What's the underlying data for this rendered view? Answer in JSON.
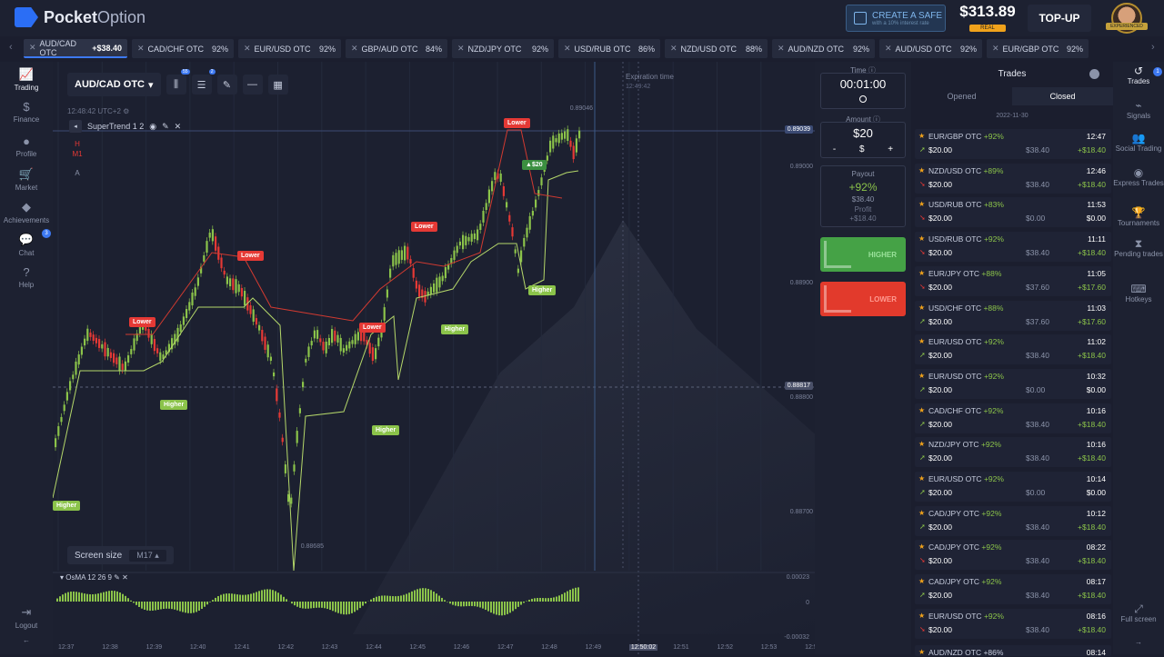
{
  "header": {
    "logo_bold": "Pocket",
    "logo_light": "Option",
    "safe_title": "CREATE A SAFE",
    "safe_sub": "with a 10% interest rate",
    "balance": "$313.89",
    "account_type": "REAL",
    "topup_label": "TOP-UP",
    "avatar_badge": "EXPERIENCED"
  },
  "ticker": [
    {
      "pair": "AUD/CAD OTC",
      "profit": "+$38.40",
      "active": true
    },
    {
      "pair": "CAD/CHF OTC",
      "pct": "92%"
    },
    {
      "pair": "EUR/USD OTC",
      "pct": "92%"
    },
    {
      "pair": "GBP/AUD OTC",
      "pct": "84%"
    },
    {
      "pair": "NZD/JPY OTC",
      "pct": "92%"
    },
    {
      "pair": "USD/RUB OTC",
      "pct": "86%"
    },
    {
      "pair": "NZD/USD OTC",
      "pct": "88%"
    },
    {
      "pair": "AUD/NZD OTC",
      "pct": "92%"
    },
    {
      "pair": "AUD/USD OTC",
      "pct": "92%"
    },
    {
      "pair": "EUR/GBP OTC",
      "pct": "92%"
    }
  ],
  "left_nav": [
    {
      "label": "Trading",
      "icon": "chart-icon"
    },
    {
      "label": "Finance",
      "icon": "dollar-icon"
    },
    {
      "label": "Profile",
      "icon": "user-icon"
    },
    {
      "label": "Market",
      "icon": "cart-icon"
    },
    {
      "label": "Achievements",
      "icon": "diamond-icon"
    },
    {
      "label": "Chat",
      "icon": "chat-icon",
      "badge": "3"
    },
    {
      "label": "Help",
      "icon": "help-icon"
    },
    {
      "label": "Logout",
      "icon": "logout-icon"
    }
  ],
  "chart": {
    "pair": "AUD/CAD OTC",
    "clock": "12:48:42 UTC+2",
    "indicator": "SuperTrend 1 2",
    "draw_tools": [
      "H",
      "M1",
      "A"
    ],
    "tool_badges": [
      "55",
      "2"
    ],
    "screen_size_label": "Screen size",
    "screen_size_value": "M17",
    "expiration_label": "Expiration time",
    "expiration_time": "12:49:42",
    "osma_label": "OsMA 12 26 9",
    "price_labels": [
      "0.89046",
      "0.89039",
      "0.89000",
      "0.88900",
      "0.88817",
      "0.88800",
      "0.88700",
      "0.88685"
    ],
    "osma_labels": [
      "0.00023",
      "0",
      "-0.00032"
    ],
    "time_labels": [
      "12:37",
      "12:38",
      "12:39",
      "12:40",
      "12:41",
      "12:42",
      "12:43",
      "12:44",
      "12:45",
      "12:46",
      "12:47",
      "12:48",
      "12:49",
      "12:50:02",
      "12:51",
      "12:52",
      "12:53",
      "12:54"
    ],
    "trade_tag": "$20",
    "signal_lower": "Lower",
    "signal_higher": "Higher"
  },
  "trade_panel": {
    "time_label": "Time",
    "time_value": "00:01:00",
    "amount_label": "Amount",
    "amount_value": "$20",
    "minus": "-",
    "currency": "$",
    "plus": "+",
    "payout_label": "Payout",
    "payout_pct": "+92%",
    "payout_amount": "$38.40",
    "profit_label": "Profit",
    "profit_value": "+$18.40",
    "higher_label": "HIGHER",
    "lower_label": "LOWER"
  },
  "trades": {
    "title": "Trades",
    "tab_opened": "Opened",
    "tab_closed": "Closed",
    "date": "2022-11-30",
    "rows": [
      {
        "pair": "EUR/GBP OTC",
        "pct": "+92%",
        "dir": "up",
        "stake": "$20.00",
        "payout": "$38.40",
        "time": "12:47",
        "profit": "+$18.40"
      },
      {
        "pair": "NZD/USD OTC",
        "pct": "+89%",
        "dir": "down",
        "stake": "$20.00",
        "payout": "$38.40",
        "time": "12:46",
        "profit": "+$18.40"
      },
      {
        "pair": "USD/RUB OTC",
        "pct": "+83%",
        "dir": "down",
        "stake": "$20.00",
        "payout": "$0.00",
        "time": "11:53",
        "profit": "$0.00"
      },
      {
        "pair": "USD/RUB OTC",
        "pct": "+92%",
        "dir": "down",
        "stake": "$20.00",
        "payout": "$38.40",
        "time": "11:11",
        "profit": "+$18.40"
      },
      {
        "pair": "EUR/JPY OTC",
        "pct": "+88%",
        "dir": "down",
        "stake": "$20.00",
        "payout": "$37.60",
        "time": "11:05",
        "profit": "+$17.60"
      },
      {
        "pair": "USD/CHF OTC",
        "pct": "+88%",
        "dir": "up",
        "stake": "$20.00",
        "payout": "$37.60",
        "time": "11:03",
        "profit": "+$17.60"
      },
      {
        "pair": "EUR/USD OTC",
        "pct": "+92%",
        "dir": "up",
        "stake": "$20.00",
        "payout": "$38.40",
        "time": "11:02",
        "profit": "+$18.40"
      },
      {
        "pair": "EUR/USD OTC",
        "pct": "+92%",
        "dir": "up",
        "stake": "$20.00",
        "payout": "$0.00",
        "time": "10:32",
        "profit": "$0.00"
      },
      {
        "pair": "CAD/CHF OTC",
        "pct": "+92%",
        "dir": "up",
        "stake": "$20.00",
        "payout": "$38.40",
        "time": "10:16",
        "profit": "+$18.40"
      },
      {
        "pair": "NZD/JPY OTC",
        "pct": "+92%",
        "dir": "up",
        "stake": "$20.00",
        "payout": "$38.40",
        "time": "10:16",
        "profit": "+$18.40"
      },
      {
        "pair": "EUR/USD OTC",
        "pct": "+92%",
        "dir": "up",
        "stake": "$20.00",
        "payout": "$0.00",
        "time": "10:14",
        "profit": "$0.00"
      },
      {
        "pair": "CAD/JPY OTC",
        "pct": "+92%",
        "dir": "up",
        "stake": "$20.00",
        "payout": "$38.40",
        "time": "10:12",
        "profit": "+$18.40"
      },
      {
        "pair": "CAD/JPY OTC",
        "pct": "+92%",
        "dir": "down",
        "stake": "$20.00",
        "payout": "$38.40",
        "time": "08:22",
        "profit": "+$18.40"
      },
      {
        "pair": "CAD/JPY OTC",
        "pct": "+92%",
        "dir": "up",
        "stake": "$20.00",
        "payout": "$38.40",
        "time": "08:17",
        "profit": "+$18.40"
      },
      {
        "pair": "EUR/USD OTC",
        "pct": "+92%",
        "dir": "down",
        "stake": "$20.00",
        "payout": "$38.40",
        "time": "08:16",
        "profit": "+$18.40"
      }
    ],
    "last_row_pair": "AUD/NZD OTC +86%",
    "last_row_time": "08:14"
  },
  "right_nav": [
    {
      "label": "Trades",
      "icon": "history-icon",
      "badge": "1"
    },
    {
      "label": "Signals",
      "icon": "signal-icon"
    },
    {
      "label": "Social Trading",
      "icon": "people-icon"
    },
    {
      "label": "Express Trades",
      "icon": "express-icon"
    },
    {
      "label": "Tournaments",
      "icon": "trophy-icon"
    },
    {
      "label": "Pending trades",
      "icon": "hourglass-icon"
    },
    {
      "label": "Hotkeys",
      "icon": "keyboard-icon"
    },
    {
      "label": "Full screen",
      "icon": "fullscreen-icon"
    }
  ],
  "colors": {
    "up": "#8bc34a",
    "down": "#e53935",
    "accent": "#3d79f2",
    "background": "#1b1e2e"
  }
}
